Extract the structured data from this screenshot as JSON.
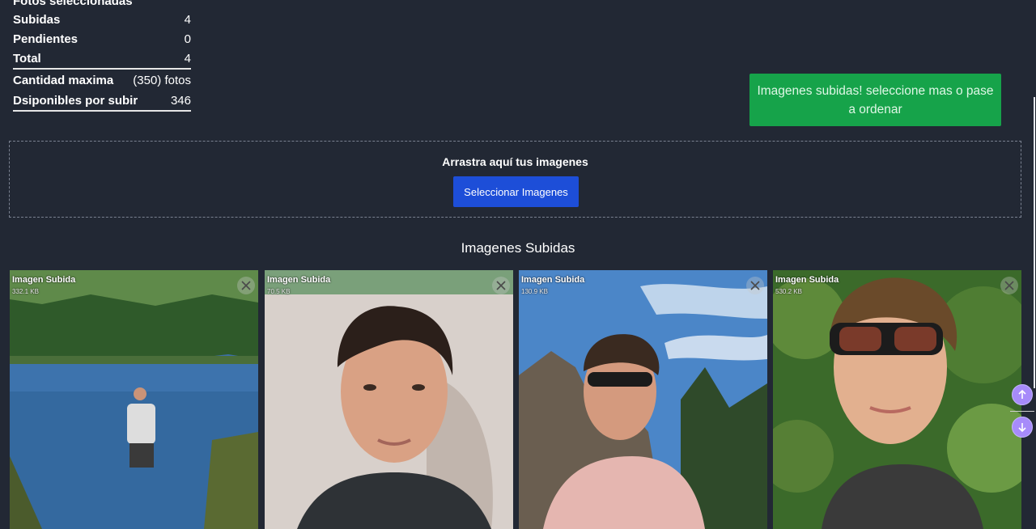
{
  "stats": {
    "heading": "Fotos seleccionadas",
    "rows": [
      {
        "label": "Subidas",
        "value": "4"
      },
      {
        "label": "Pendientes",
        "value": "0"
      },
      {
        "label": "Total",
        "value": "4"
      },
      {
        "label": "Cantidad maxima",
        "value": "(350) fotos"
      },
      {
        "label": "Dsiponibles por subir",
        "value": "346"
      }
    ]
  },
  "toast": {
    "message": "Imagenes subidas! seleccione mas o pase a ordenar",
    "color": "#16a34a"
  },
  "dropzone": {
    "title": "Arrastra aquí tus imagenes",
    "button_label": "Seleccionar Imagenes",
    "button_color": "#1d4ed8"
  },
  "uploaded": {
    "title": "Imagenes Subidas",
    "cards": [
      {
        "label": "Imagen Subida",
        "size": "332.1 KB"
      },
      {
        "label": "Imagen Subida",
        "size": "70.5 KB"
      },
      {
        "label": "Imagen Subida",
        "size": "130.9 KB"
      },
      {
        "label": "Imagen Subida",
        "size": "530.2 KB"
      }
    ]
  },
  "icons": {
    "close": "close-icon",
    "scroll_up": "arrow-up-icon",
    "scroll_down": "arrow-down-icon"
  }
}
